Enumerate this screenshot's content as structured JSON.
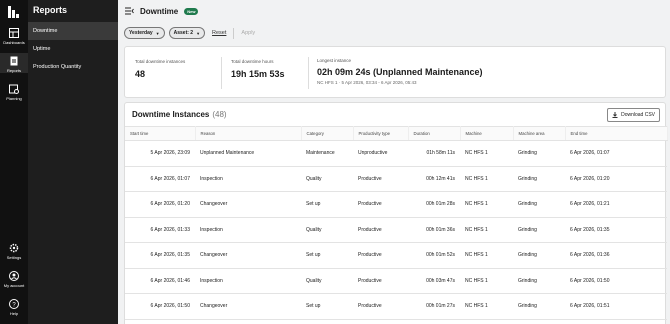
{
  "rail": {
    "items": [
      {
        "label": "Dashboards",
        "icon": "dashboard-icon"
      },
      {
        "label": "Reports",
        "icon": "report-icon"
      },
      {
        "label": "Planning",
        "icon": "planning-icon"
      },
      {
        "label": "Settings",
        "icon": "gear-icon"
      },
      {
        "label": "My account",
        "icon": "account-icon"
      },
      {
        "label": "Help",
        "icon": "help-icon"
      }
    ]
  },
  "subnav": {
    "title": "Reports",
    "items": [
      {
        "label": "Downtime"
      },
      {
        "label": "Uptime"
      },
      {
        "label": "Production Quantity"
      }
    ]
  },
  "header": {
    "title": "Downtime",
    "badge": "New"
  },
  "filters": {
    "period": "Yesterday",
    "asset": "Asset: 2",
    "reset": "Reset",
    "apply": "Apply"
  },
  "stats": {
    "total_instances_label": "Total downtime instances",
    "total_instances_value": "48",
    "total_hours_label": "Total downtime hours",
    "total_hours_value": "19h 15m 53s",
    "longest_label": "Longest instance",
    "longest_value": "02h 09m 24s (Unplanned Maintenance)",
    "longest_meta": "NC HFS 1  ·  5 Apr 2026, 03:34 - 6 Apr 2026, 05:43"
  },
  "table": {
    "title": "Downtime Instances",
    "count": "(48)",
    "download_label": "Download CSV",
    "columns": [
      "Start time",
      "Reason",
      "Category",
      "Productivity type",
      "Duration",
      "Machine",
      "Machine area",
      "End time"
    ],
    "rows": [
      [
        "5 Apr 2026, 23:09",
        "Unplanned Maintenance",
        "Maintenance",
        "Unproductive",
        "01h 58m 11s",
        "NC HFS 1",
        "Grinding",
        "6 Apr 2026, 01:07"
      ],
      [
        "6 Apr 2026, 01:07",
        "Inspection",
        "Quality",
        "Productive",
        "00h 12m 41s",
        "NC HFS 1",
        "Grinding",
        "6 Apr 2026, 01:20"
      ],
      [
        "6 Apr 2026, 01:20",
        "Changeover",
        "Set up",
        "Productive",
        "00h 01m 28s",
        "NC HFS 1",
        "Grinding",
        "6 Apr 2026, 01:21"
      ],
      [
        "6 Apr 2026, 01:33",
        "Inspection",
        "Quality",
        "Productive",
        "00h 01m 36s",
        "NC HFS 1",
        "Grinding",
        "6 Apr 2026, 01:35"
      ],
      [
        "6 Apr 2026, 01:35",
        "Changeover",
        "Set up",
        "Productive",
        "00h 01m 52s",
        "NC HFS 1",
        "Grinding",
        "6 Apr 2026, 01:36"
      ],
      [
        "6 Apr 2026, 01:46",
        "Inspection",
        "Quality",
        "Productive",
        "00h 03m 47s",
        "NC HFS 1",
        "Grinding",
        "6 Apr 2026, 01:50"
      ],
      [
        "6 Apr 2026, 01:50",
        "Changeover",
        "Set up",
        "Productive",
        "00h 01m 27s",
        "NC HFS 1",
        "Grinding",
        "6 Apr 2026, 01:51"
      ]
    ]
  },
  "colors": {
    "rail_bg": "#111111",
    "subnav_bg": "#1e1e1e",
    "badge": "#1f7a4d"
  }
}
